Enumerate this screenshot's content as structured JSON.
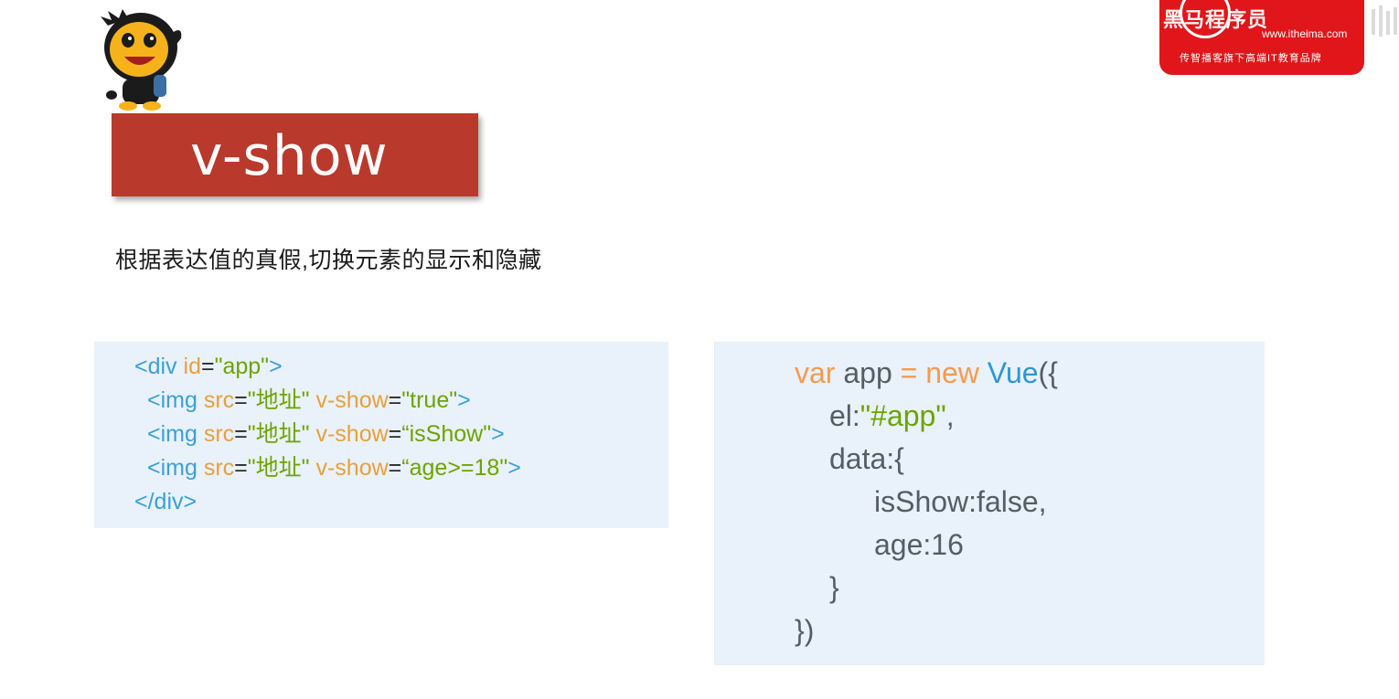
{
  "slide": {
    "title": "v-show",
    "description": "根据表达值的真假,切换元素的显示和隐藏"
  },
  "logo": {
    "brand": "黑马程序员",
    "url": "www.itheima.com",
    "slogan": "传智播客旗下高端IT教育品牌"
  },
  "html_code": {
    "line1": {
      "open": "<div ",
      "attr": "id",
      "eq": "=",
      "val": "\"app\"",
      "close": ">"
    },
    "line2": {
      "open": "<img ",
      "attr1": "src",
      "eq1": "=",
      "val1": "\"地址\"",
      "attr2": " v-show",
      "eq2": "=",
      "val2": "\"true\"",
      "close": ">"
    },
    "line3": {
      "open": "<img ",
      "attr1": "src",
      "eq1": "=",
      "val1": "\"地址\"",
      "attr2": " v-show",
      "eq2": "=",
      "val2": "“isShow\"",
      "close": ">"
    },
    "line4": {
      "open": "<img ",
      "attr1": "src",
      "eq1": "=",
      "val1": "\"地址\"",
      "attr2": " v-show",
      "eq2": "=",
      "val2": "“age>=18\"",
      "close": ">"
    },
    "line5": {
      "close": "</div>"
    }
  },
  "js_code": {
    "line1": {
      "kw1": "var",
      "name": " app ",
      "op": "=",
      "kw2": " new ",
      "cls": "Vue",
      "tail": "({"
    },
    "line2": {
      "key": "el:",
      "val": "\"#app\"",
      "tail": ","
    },
    "line3": {
      "text": "data:{"
    },
    "line4": {
      "text": "isShow:false,"
    },
    "line5": {
      "text": "age:16"
    },
    "line6": {
      "text": "}"
    },
    "line7": {
      "text": "})"
    }
  },
  "colors": {
    "title_bg": "#b93a2c",
    "code_bg": "#e9f1fb",
    "logo_bg": "#e0161b"
  },
  "icons": [
    "mascot-icon",
    "brand-logo-icon"
  ]
}
